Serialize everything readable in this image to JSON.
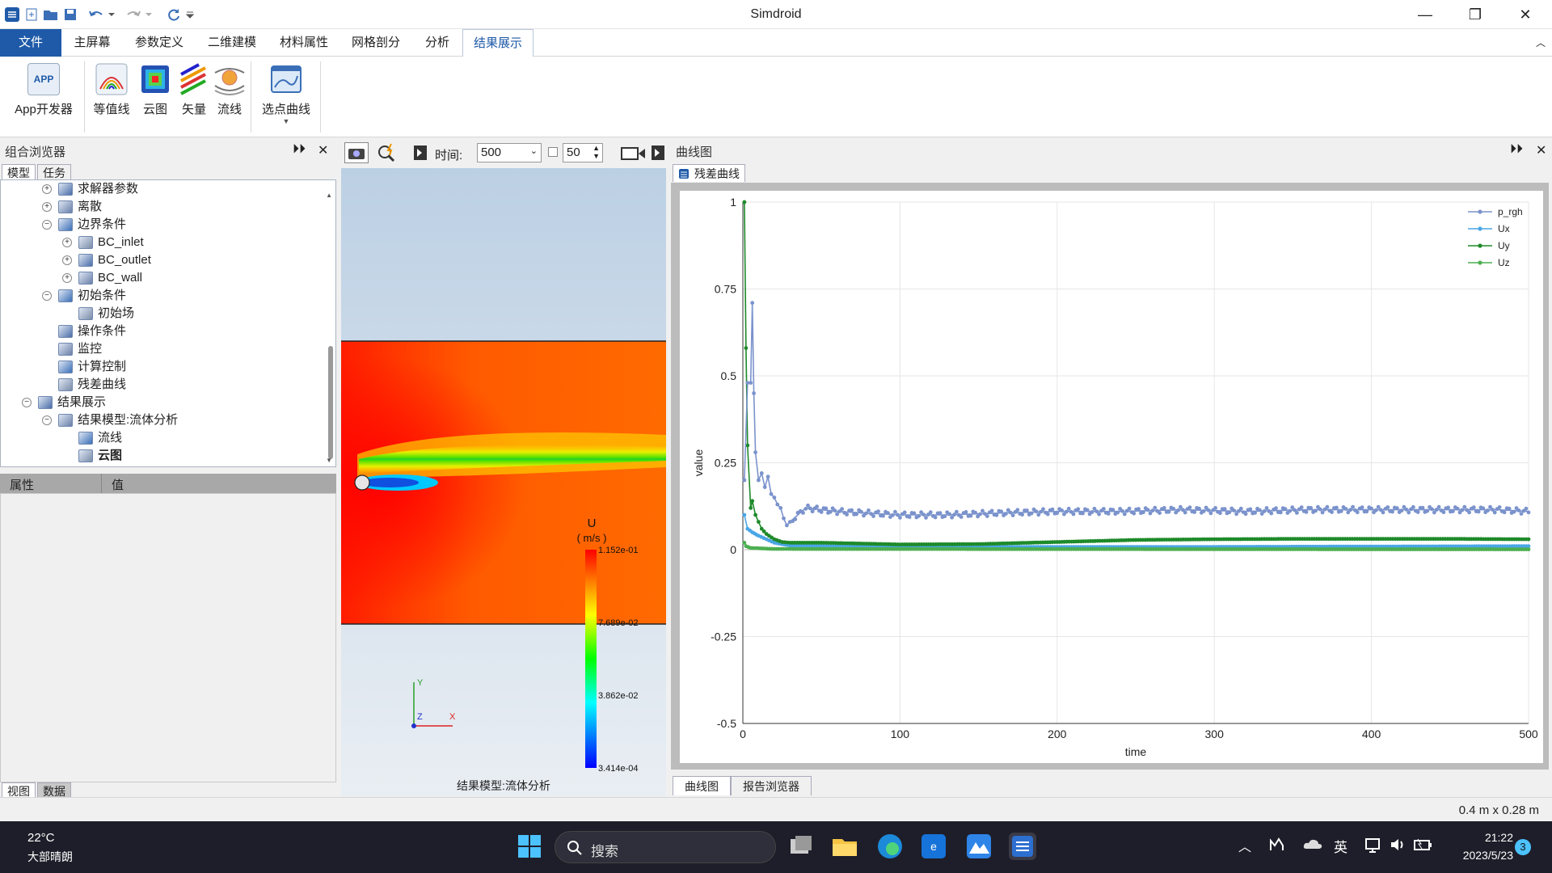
{
  "app": {
    "title": "Simdroid"
  },
  "window_controls": {
    "minimize": "—",
    "restore": "❐",
    "close": "✕"
  },
  "menu": {
    "tabs": [
      "文件",
      "主屏幕",
      "参数定义",
      "二维建模",
      "材料属性",
      "网格剖分",
      "分析",
      "结果展示"
    ],
    "active": "结果展示",
    "collapse_glyph": "︿"
  },
  "ribbon": {
    "buttons": [
      {
        "label": "App开发器",
        "icon": "app-developer-icon",
        "text": "APP"
      },
      {
        "label": "等值线",
        "icon": "contour-icon"
      },
      {
        "label": "云图",
        "icon": "cloud-map-icon"
      },
      {
        "label": "矢量",
        "icon": "vector-icon"
      },
      {
        "label": "流线",
        "icon": "streamline-icon"
      },
      {
        "label": "选点曲线",
        "icon": "point-curve-icon"
      }
    ]
  },
  "left_panel": {
    "title": "组合浏览器",
    "tabs": [
      "模型",
      "任务"
    ],
    "tree": [
      {
        "label": "求解器参数",
        "level": 2,
        "exp": "+",
        "icon": "solver-icon",
        "bold": false
      },
      {
        "label": "离散",
        "level": 2,
        "exp": "+",
        "icon": "discrete-icon",
        "bold": false
      },
      {
        "label": "边界条件",
        "level": 2,
        "exp": "−",
        "icon": "boundary-icon",
        "bold": false
      },
      {
        "label": "BC_inlet",
        "level": 3,
        "exp": "+",
        "icon": "bc-icon",
        "bold": false
      },
      {
        "label": "BC_outlet",
        "level": 3,
        "exp": "+",
        "icon": "bc-icon",
        "bold": false
      },
      {
        "label": "BC_wall",
        "level": 3,
        "exp": "+",
        "icon": "bc-icon",
        "bold": false
      },
      {
        "label": "初始条件",
        "level": 2,
        "exp": "−",
        "icon": "initial-icon",
        "bold": false
      },
      {
        "label": "初始场",
        "level": 3,
        "exp": "",
        "icon": "field-icon",
        "bold": false
      },
      {
        "label": "操作条件",
        "level": 2,
        "exp": "",
        "icon": "operating-icon",
        "bold": false
      },
      {
        "label": "监控",
        "level": 2,
        "exp": "",
        "icon": "monitor-icon",
        "bold": false
      },
      {
        "label": "计算控制",
        "level": 2,
        "exp": "",
        "icon": "compute-icon",
        "bold": false
      },
      {
        "label": "残差曲线",
        "level": 2,
        "exp": "",
        "icon": "residual-icon",
        "bold": false
      },
      {
        "label": "结果展示",
        "level": 1,
        "exp": "−",
        "icon": "result-icon",
        "bold": false
      },
      {
        "label": "结果模型:流体分析",
        "level": 2,
        "exp": "−",
        "icon": "result-model-icon",
        "bold": false
      },
      {
        "label": "流线",
        "level": 3,
        "exp": "",
        "icon": "streamline-icon",
        "bold": false
      },
      {
        "label": "云图",
        "level": 3,
        "exp": "",
        "icon": "cloud-map-icon",
        "bold": true
      }
    ],
    "properties": {
      "col_attr": "属性",
      "col_value": "值"
    },
    "bottom_tabs": [
      "视图",
      "数据"
    ]
  },
  "viewport": {
    "toolbar": {
      "time_label": "时间:",
      "time_value": "500",
      "step_value": "50"
    },
    "legend": {
      "title": "U",
      "unit": "( m/s )",
      "ticks": [
        "1.152e-01",
        "7.689e-02",
        "3.862e-02",
        "3.414e-04"
      ]
    },
    "axes": {
      "y": "Y",
      "z": "Z",
      "x": "X"
    },
    "label": "结果模型:流体分析"
  },
  "right_panel": {
    "title": "曲线图",
    "tab": "残差曲线",
    "bottom_tabs": [
      "曲线图",
      "报告浏览器"
    ]
  },
  "chart_data": {
    "type": "line",
    "title": "",
    "xlabel": "time",
    "ylabel": "value",
    "xlim": [
      0,
      500
    ],
    "ylim": [
      -0.5,
      1
    ],
    "xticks": [
      0,
      100,
      200,
      300,
      400,
      500
    ],
    "yticks": [
      -0.5,
      -0.25,
      0,
      0.25,
      0.5,
      0.75,
      1
    ],
    "ytick_labels": [
      "-0.5",
      "-0.25",
      "0",
      "0.25",
      "0.5",
      "0.75",
      "1"
    ],
    "grid": true,
    "legend": "top-right",
    "series": [
      {
        "name": "p_rgh",
        "color": "#7b93cc",
        "points": [
          [
            1,
            0.2
          ],
          [
            3,
            0.48
          ],
          [
            5,
            0.48
          ],
          [
            6,
            0.71
          ],
          [
            7,
            0.45
          ],
          [
            8,
            0.28
          ],
          [
            10,
            0.2
          ],
          [
            12,
            0.22
          ],
          [
            14,
            0.18
          ],
          [
            16,
            0.21
          ],
          [
            18,
            0.16
          ],
          [
            20,
            0.15
          ],
          [
            22,
            0.13
          ],
          [
            24,
            0.12
          ],
          [
            26,
            0.09
          ],
          [
            28,
            0.07
          ],
          [
            30,
            0.08
          ],
          [
            35,
            0.1
          ],
          [
            40,
            0.12
          ],
          [
            50,
            0.115
          ],
          [
            60,
            0.11
          ],
          [
            80,
            0.105
          ],
          [
            100,
            0.1
          ],
          [
            130,
            0.1
          ],
          [
            160,
            0.105
          ],
          [
            200,
            0.11
          ],
          [
            240,
            0.11
          ],
          [
            280,
            0.115
          ],
          [
            320,
            0.11
          ],
          [
            360,
            0.115
          ],
          [
            400,
            0.115
          ],
          [
            440,
            0.115
          ],
          [
            480,
            0.115
          ],
          [
            500,
            0.11
          ]
        ]
      },
      {
        "name": "Ux",
        "color": "#4aa6e6",
        "points": [
          [
            1,
            0.1
          ],
          [
            3,
            0.06
          ],
          [
            6,
            0.05
          ],
          [
            10,
            0.04
          ],
          [
            15,
            0.03
          ],
          [
            20,
            0.02
          ],
          [
            30,
            0.012
          ],
          [
            50,
            0.01
          ],
          [
            100,
            0.008
          ],
          [
            200,
            0.008
          ],
          [
            300,
            0.008
          ],
          [
            400,
            0.009
          ],
          [
            500,
            0.01
          ]
        ]
      },
      {
        "name": "Uy",
        "color": "#1e8a2a",
        "points": [
          [
            1,
            1.0
          ],
          [
            2,
            0.58
          ],
          [
            3,
            0.3
          ],
          [
            5,
            0.12
          ],
          [
            6,
            0.14
          ],
          [
            8,
            0.1
          ],
          [
            10,
            0.08
          ],
          [
            12,
            0.06
          ],
          [
            15,
            0.045
          ],
          [
            20,
            0.03
          ],
          [
            25,
            0.022
          ],
          [
            30,
            0.02
          ],
          [
            50,
            0.02
          ],
          [
            100,
            0.015
          ],
          [
            150,
            0.016
          ],
          [
            200,
            0.022
          ],
          [
            250,
            0.028
          ],
          [
            300,
            0.03
          ],
          [
            350,
            0.031
          ],
          [
            400,
            0.031
          ],
          [
            450,
            0.031
          ],
          [
            500,
            0.03
          ]
        ]
      },
      {
        "name": "Uz",
        "color": "#4caf50",
        "points": [
          [
            1,
            0.02
          ],
          [
            2,
            0.01
          ],
          [
            5,
            0.005
          ],
          [
            20,
            0.002
          ],
          [
            500,
            0.001
          ]
        ]
      }
    ]
  },
  "status": {
    "size": "0.4 m x 0.28 m"
  },
  "taskbar": {
    "weather_temp": "22°C",
    "weather_desc": "大部晴朗",
    "search": "搜索",
    "lang": "英",
    "time": "21:22",
    "date": "2023/5/23",
    "badge": "3"
  }
}
